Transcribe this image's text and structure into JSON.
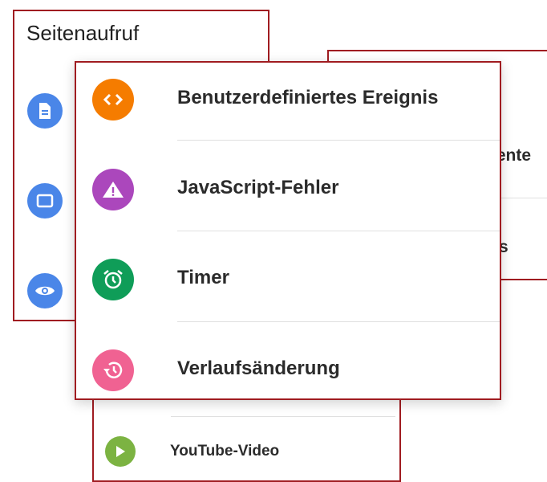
{
  "seitenaufruf_panel": {
    "title": "Seitenaufruf",
    "icon_color": "#4a86e8",
    "icons": [
      "document-icon",
      "window-icon",
      "eye-icon"
    ]
  },
  "right_panel": {
    "partial_item_1": "nente",
    "partial_item_2": "s"
  },
  "bottom_panel": {
    "youtube_label": "YouTube-Video",
    "youtube_color": "#7cb342"
  },
  "main_panel": {
    "items": [
      {
        "label": "Benutzerdefiniertes Ereignis",
        "icon": "code-icon",
        "color": "#f57c00"
      },
      {
        "label": "JavaScript-Fehler",
        "icon": "warning-icon",
        "color": "#ab47bc"
      },
      {
        "label": "Timer",
        "icon": "alarm-clock-icon",
        "color": "#0f9d58"
      },
      {
        "label": "Verlaufsänderung",
        "icon": "history-icon",
        "color": "#f06292"
      }
    ]
  }
}
